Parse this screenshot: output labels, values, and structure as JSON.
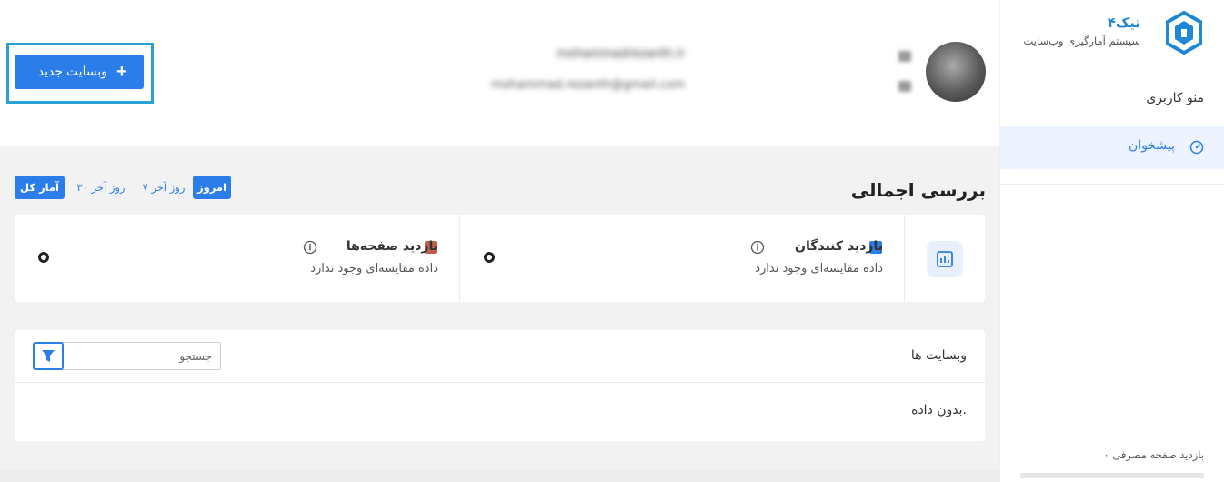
{
  "brand": {
    "title": "تیک۴",
    "subtitle": "سیستم آمارگیری وب‌سایت",
    "logo_icon": "tik4-hexagon-logo",
    "color": "#1e88d6"
  },
  "sidebar": {
    "menu_heading": "منو کاربری",
    "items": [
      {
        "label": "پیشخوان",
        "icon": "dashboard-gauge-icon",
        "active": true
      }
    ],
    "footer": "۰ بازدید صفحه مصرفی"
  },
  "header": {
    "new_site_label": "وبسایت جدید",
    "user_name": "mohammadrezanth.ir",
    "user_email": "mohammad.rezanth@gmail.com"
  },
  "overview": {
    "title": "بررسی اجمالی",
    "ranges": [
      "امروز",
      "۷ روز آخر",
      "۳۰ روز آخر",
      "آمار کل"
    ],
    "active_ranges": [
      "امروز",
      "آمار کل"
    ]
  },
  "stats": [
    {
      "title": "بازدید کنندگان",
      "subtitle": "داده مقایسه‌ای وجود ندارد",
      "color": "#2b7de9"
    },
    {
      "title": "بازدید صفحه‌ها",
      "subtitle": "داده مقایسه‌ای وجود ندارد",
      "color": "#c0604a"
    }
  ],
  "websites": {
    "title": "وبسایت ها",
    "search_placeholder": "جستجو",
    "empty_text": "بدون داده."
  },
  "colors": {
    "accent": "#2b7de9",
    "highlight_frame": "#2aa0d8",
    "active_menu_bg": "#eef4ff"
  }
}
